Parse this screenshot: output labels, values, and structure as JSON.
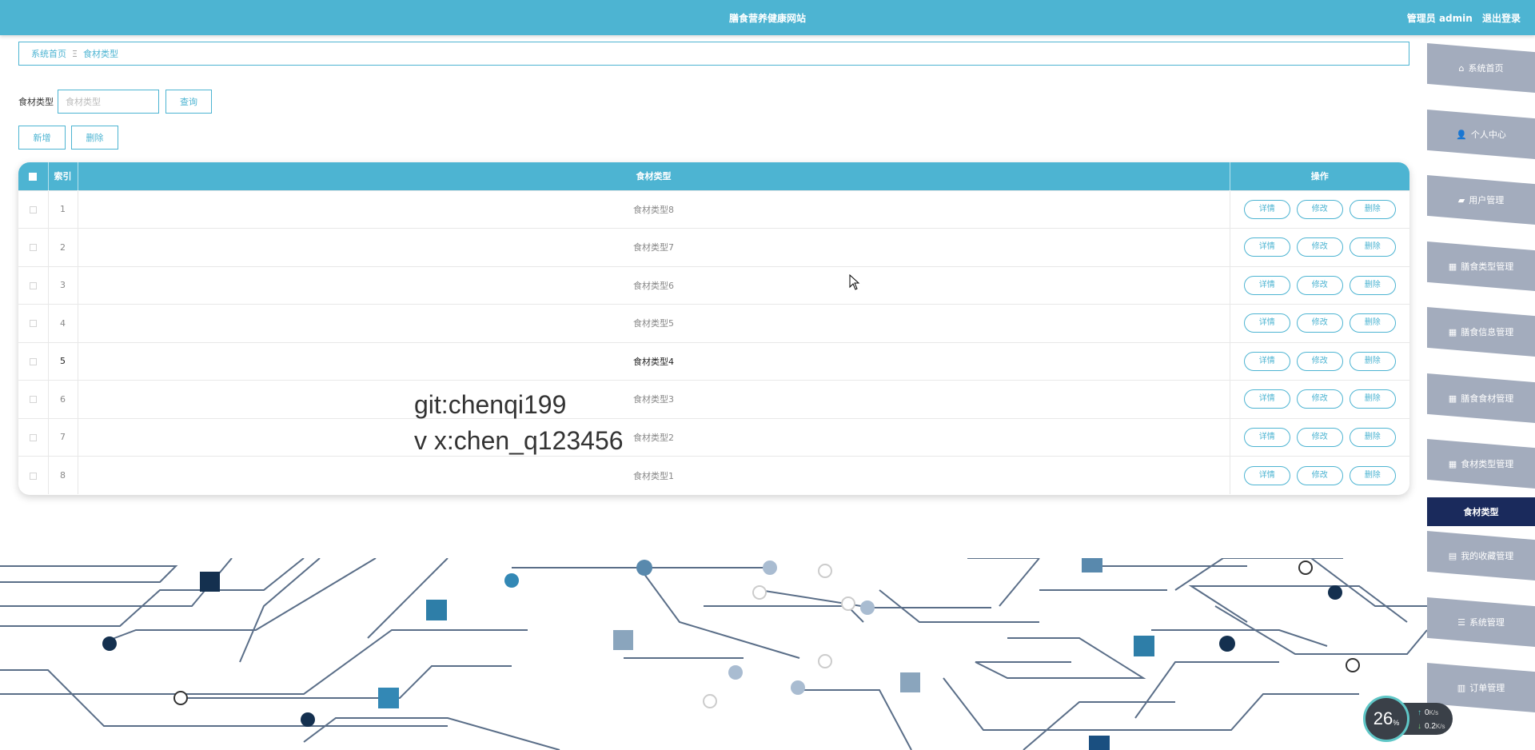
{
  "header": {
    "title": "膳食营养健康网站",
    "user_label": "管理员 admin",
    "logout": "退出登录"
  },
  "breadcrumb": {
    "home": "系统首页",
    "separator": "Ξ",
    "current": "食材类型"
  },
  "search": {
    "label": "食材类型",
    "placeholder": "食材类型",
    "query_button": "查询"
  },
  "actions": {
    "add": "新增",
    "delete": "删除"
  },
  "table": {
    "headers": {
      "index": "索引",
      "type": "食材类型",
      "ops": "操作"
    },
    "op_labels": {
      "detail": "详情",
      "edit": "修改",
      "delete": "删除"
    },
    "rows": [
      {
        "index": "1",
        "type": "食材类型8"
      },
      {
        "index": "2",
        "type": "食材类型7"
      },
      {
        "index": "3",
        "type": "食材类型6"
      },
      {
        "index": "4",
        "type": "食材类型5"
      },
      {
        "index": "5",
        "type": "食材类型4"
      },
      {
        "index": "6",
        "type": "食材类型3"
      },
      {
        "index": "7",
        "type": "食材类型2"
      },
      {
        "index": "8",
        "type": "食材类型1"
      }
    ]
  },
  "watermark": {
    "line1": "git:chenqi199",
    "line2": "v x:chen_q123456"
  },
  "sidebar": {
    "items": [
      {
        "label": "系统首页",
        "icon": "home-icon"
      },
      {
        "label": "个人中心",
        "icon": "user-icon"
      },
      {
        "label": "用户管理",
        "icon": "briefcase-icon"
      },
      {
        "label": "膳食类型管理",
        "icon": "grid-icon"
      },
      {
        "label": "膳食信息管理",
        "icon": "grid-icon"
      },
      {
        "label": "膳食食材管理",
        "icon": "grid-icon"
      },
      {
        "label": "食材类型管理",
        "icon": "grid-icon"
      },
      {
        "label": "食材类型",
        "icon": "",
        "active": true
      },
      {
        "label": "我的收藏管理",
        "icon": "clipboard-icon"
      },
      {
        "label": "系统管理",
        "icon": "menu-icon"
      },
      {
        "label": "订单管理",
        "icon": "table-icon"
      }
    ]
  },
  "network": {
    "percent": "26",
    "percent_unit": "%",
    "up": "0",
    "down": "0.2",
    "unit": "K/s"
  },
  "colors": {
    "accent": "#4db4d2",
    "sidebar_bg": "#a3acbd",
    "sidebar_active": "#1a2a5c"
  }
}
